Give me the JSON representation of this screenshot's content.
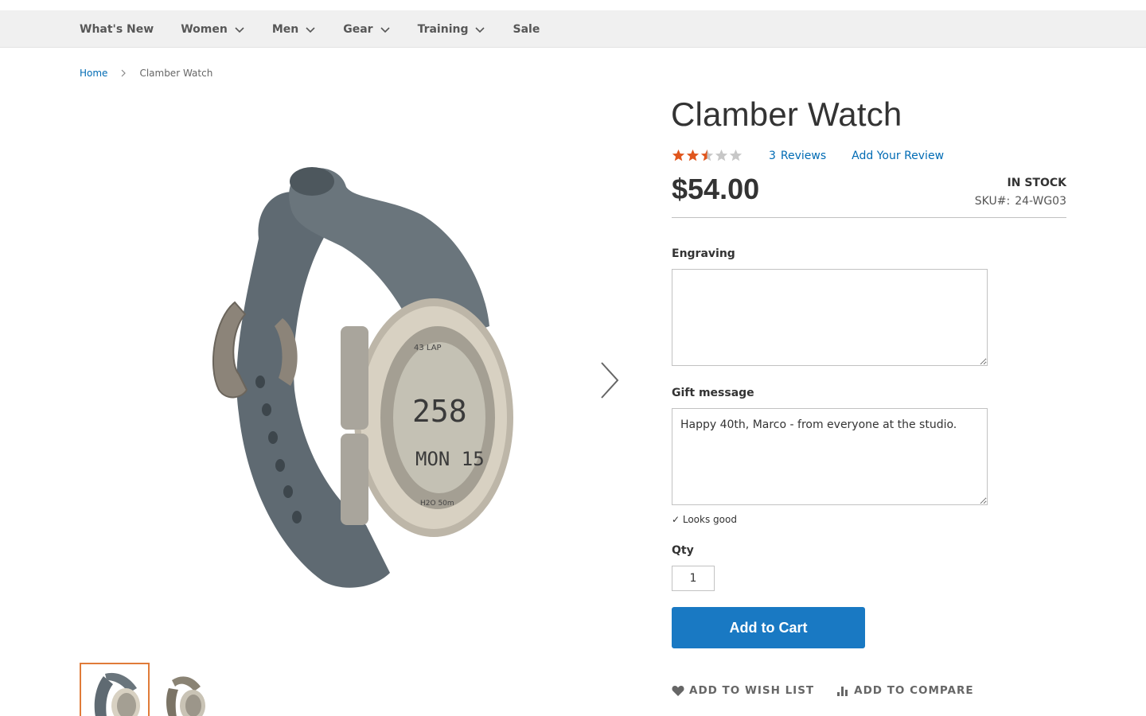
{
  "nav": {
    "items": [
      {
        "label": "What's New",
        "has_dropdown": false
      },
      {
        "label": "Women",
        "has_dropdown": true
      },
      {
        "label": "Men",
        "has_dropdown": true
      },
      {
        "label": "Gear",
        "has_dropdown": true
      },
      {
        "label": "Training",
        "has_dropdown": true
      },
      {
        "label": "Sale",
        "has_dropdown": false
      }
    ]
  },
  "breadcrumb": {
    "home": "Home",
    "current": "Clamber Watch"
  },
  "product": {
    "title": "Clamber Watch",
    "rating_fraction": 0.5,
    "rating_color": "#e0561d",
    "reviews_count": "3",
    "reviews_label": "Reviews",
    "add_review_label": "Add Your Review",
    "price": "$54.00",
    "stock": "IN STOCK",
    "sku_label": "SKU#:",
    "sku_value": "24-WG03"
  },
  "form": {
    "engraving_label": "Engraving",
    "engraving_value": "",
    "gift_label": "Gift message",
    "gift_value": "Happy 40th, Marco - from everyone at the studio.",
    "validation_note": "✓ Looks good",
    "qty_label": "Qty",
    "qty_value": "1",
    "add_to_cart_label": "Add to Cart"
  },
  "actions": {
    "wishlist_label": "ADD TO WISH LIST",
    "compare_label": "ADD TO COMPARE"
  },
  "colors": {
    "link": "#006bb4",
    "primary_button": "#1979c3",
    "thumb_active_border": "#e07b39"
  }
}
